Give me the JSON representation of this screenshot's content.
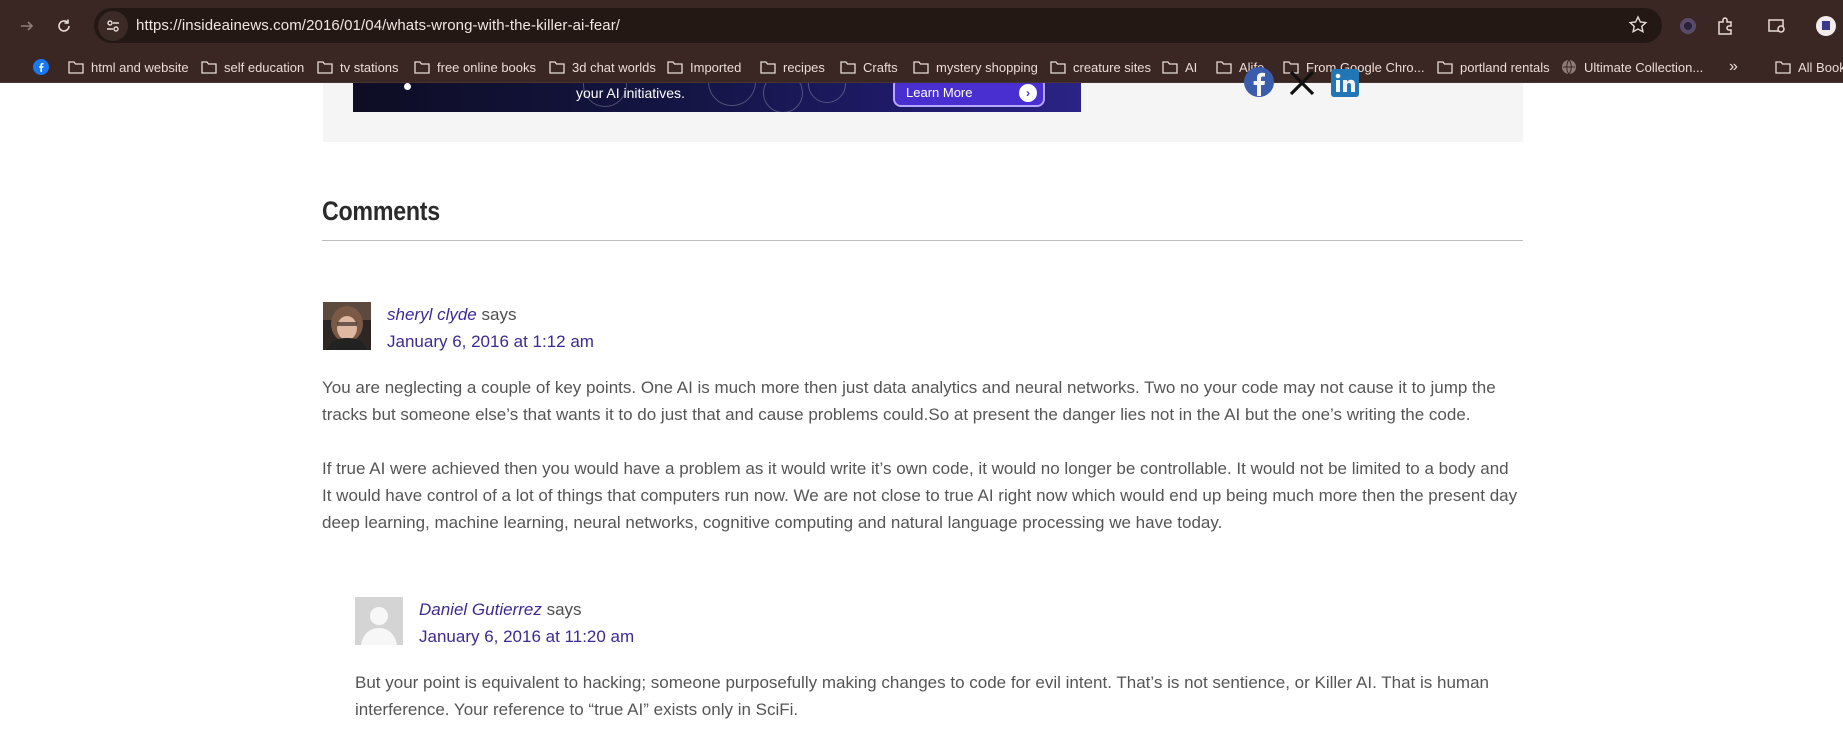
{
  "browser": {
    "url": "https://insideainews.com/2016/01/04/whats-wrong-with-the-killer-ai-fear/",
    "colors": {
      "toolbar": "#3a2622",
      "omnibox": "#241815"
    },
    "icons": [
      "forward-icon",
      "reload-icon",
      "site-info-icon",
      "star-icon",
      "extension-icon",
      "puzzle-icon",
      "media-icon",
      "profile-icon"
    ]
  },
  "bookmarks": {
    "items": [
      {
        "label": "",
        "icon": "facebook-icon"
      },
      {
        "label": "html and website",
        "icon": "folder-icon"
      },
      {
        "label": "self education",
        "icon": "folder-icon"
      },
      {
        "label": "tv stations",
        "icon": "folder-icon"
      },
      {
        "label": "free online books",
        "icon": "folder-icon"
      },
      {
        "label": "3d chat worlds",
        "icon": "folder-icon"
      },
      {
        "label": "Imported",
        "icon": "folder-icon"
      },
      {
        "label": "recipes",
        "icon": "folder-icon"
      },
      {
        "label": "Crafts",
        "icon": "folder-icon"
      },
      {
        "label": "mystery shopping",
        "icon": "folder-icon"
      },
      {
        "label": "creature sites",
        "icon": "folder-icon"
      },
      {
        "label": "AI",
        "icon": "folder-icon"
      },
      {
        "label": "Alife",
        "icon": "folder-icon"
      },
      {
        "label": "From Google Chro...",
        "icon": "folder-icon"
      },
      {
        "label": "portland rentals",
        "icon": "folder-icon"
      },
      {
        "label": "Ultimate Collection...",
        "icon": "globe-icon"
      }
    ],
    "overflow": "»",
    "all_bookmarks": "All Book"
  },
  "ad": {
    "text": "your AI initiatives.",
    "button_label": "Learn More",
    "colors": {
      "button": "#4a2fd0"
    }
  },
  "social": [
    "facebook-icon",
    "x-icon",
    "linkedin-icon"
  ],
  "comments": {
    "heading": "Comments",
    "items": [
      {
        "author": "sheryl clyde",
        "says": "says",
        "date": "January 6, 2016 at 1:12 am",
        "paragraphs": [
          [
            "You are neglecting a couple of key points. One AI is much more then just data analytics and neural networks. Two no your code may not cause it to jump the",
            "tracks but someone else’s that wants it to do just that and cause problems could.So at present the danger lies not in the AI but the one’s writing the code."
          ],
          [
            "If true AI were achieved then you would have a problem as it would write it’s own code, it would no longer be controllable. It would not be limited to a body and",
            "It would have control of a lot of things that computers run now. We are not close to true AI right now which would end up being much more then the present day",
            "deep learning, machine learning, neural networks, cognitive computing and natural language processing we have today."
          ]
        ]
      },
      {
        "author": "Daniel Gutierrez",
        "says": "says",
        "date": "January 6, 2016 at 11:20 am",
        "paragraphs": [
          [
            "But your point is equivalent to hacking; someone purposefully making changes to code for evil intent. That’s is not sentience, or Killer AI. That is human",
            "interference. Your reference to “true AI” exists only in SciFi."
          ]
        ]
      }
    ],
    "colors": {
      "link": "#3e2a93",
      "text": "#555555"
    }
  }
}
